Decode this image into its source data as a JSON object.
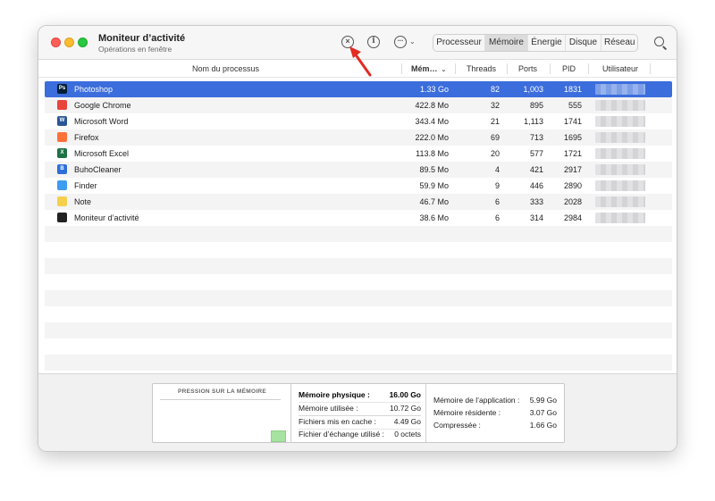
{
  "window": {
    "title": "Moniteur d’activité",
    "subtitle": "Opérations en fenêtre"
  },
  "toolbar": {
    "stop_icon": "stop-process-icon",
    "info_icon": "info-icon",
    "more_icon": "ellipsis-icon",
    "tabs": [
      {
        "label": "Processeur",
        "active": false
      },
      {
        "label": "Mémoire",
        "active": true
      },
      {
        "label": "Énergie",
        "active": false
      },
      {
        "label": "Disque",
        "active": false
      },
      {
        "label": "Réseau",
        "active": false
      }
    ],
    "search_icon": "search-icon"
  },
  "table": {
    "columns": {
      "name": "Nom du processus",
      "memory": "Mém…",
      "threads": "Threads",
      "ports": "Ports",
      "pid": "PID",
      "user": "Utilisateur"
    },
    "rows": [
      {
        "name": "Photoshop",
        "icon": "photoshop-icon",
        "icon_color": "#001e36",
        "icon_text": "Ps",
        "memory": "1.33 Go",
        "threads": "82",
        "ports": "1,003",
        "pid": "1831",
        "selected": true
      },
      {
        "name": "Google Chrome",
        "icon": "chrome-icon",
        "icon_color": "#e8453c",
        "icon_text": "",
        "memory": "422.8 Mo",
        "threads": "32",
        "ports": "895",
        "pid": "555",
        "selected": false
      },
      {
        "name": "Microsoft Word",
        "icon": "word-icon",
        "icon_color": "#2b5797",
        "icon_text": "W",
        "memory": "343.4 Mo",
        "threads": "21",
        "ports": "1,113",
        "pid": "1741",
        "selected": false
      },
      {
        "name": "Firefox",
        "icon": "firefox-icon",
        "icon_color": "#ff7139",
        "icon_text": "",
        "memory": "222.0 Mo",
        "threads": "69",
        "ports": "713",
        "pid": "1695",
        "selected": false
      },
      {
        "name": "Microsoft Excel",
        "icon": "excel-icon",
        "icon_color": "#1e7145",
        "icon_text": "X",
        "memory": "113.8 Mo",
        "threads": "20",
        "ports": "577",
        "pid": "1721",
        "selected": false
      },
      {
        "name": "BuhoCleaner",
        "icon": "buhocleaner-icon",
        "icon_color": "#2d6fd8",
        "icon_text": "B",
        "memory": "89.5 Mo",
        "threads": "4",
        "ports": "421",
        "pid": "2917",
        "selected": false
      },
      {
        "name": "Finder",
        "icon": "finder-icon",
        "icon_color": "#3d9bf0",
        "icon_text": "",
        "memory": "59.9 Mo",
        "threads": "9",
        "ports": "446",
        "pid": "2890",
        "selected": false
      },
      {
        "name": "Note",
        "icon": "notes-icon",
        "icon_color": "#f5d04c",
        "icon_text": "",
        "memory": "46.7 Mo",
        "threads": "6",
        "ports": "333",
        "pid": "2028",
        "selected": false
      },
      {
        "name": "Moniteur d’activité",
        "icon": "activity-monitor-icon",
        "icon_color": "#222222",
        "icon_text": "",
        "memory": "38.6 Mo",
        "threads": "6",
        "ports": "314",
        "pid": "2984",
        "selected": false
      }
    ],
    "empty_rows": 9
  },
  "footer": {
    "pressure_title": "PRESSION SUR LA MÉMOIRE",
    "pressure_color": "#a6e3a0",
    "stats_left": [
      {
        "label": "Mémoire physique :",
        "value": "16.00 Go"
      },
      {
        "label": "Mémoire utilisée :",
        "value": "10.72 Go"
      },
      {
        "label": "Fichiers mis en cache :",
        "value": "4.49 Go"
      },
      {
        "label": "Fichier d’échange utilisé :",
        "value": "0 octets"
      }
    ],
    "stats_right": [
      {
        "label": "Mémoire de l’application :",
        "value": "5.99 Go"
      },
      {
        "label": "Mémoire résidente :",
        "value": "3.07 Go"
      },
      {
        "label": "Compressée :",
        "value": "1.66 Go"
      }
    ]
  },
  "colors": {
    "selection": "#3b6ddc",
    "annotation_arrow": "#e32b22"
  }
}
